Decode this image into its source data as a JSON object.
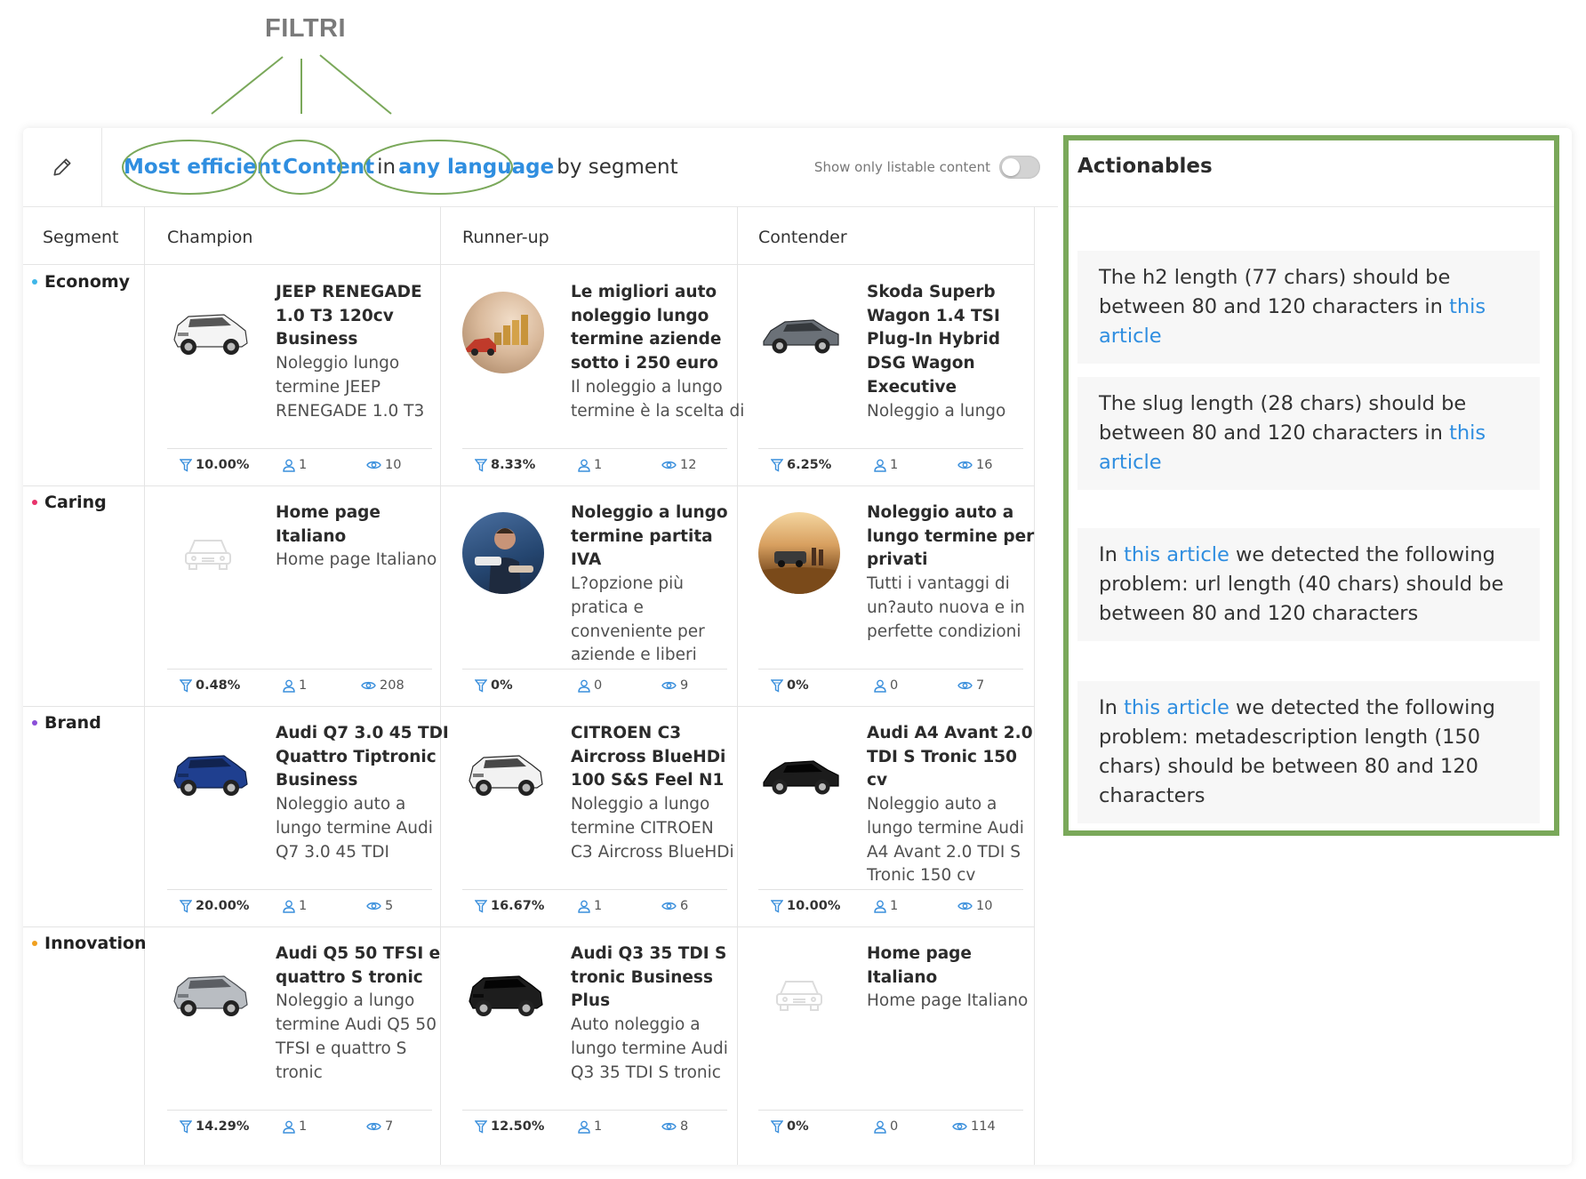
{
  "annotation": {
    "label": "FILTRI"
  },
  "query": {
    "metric": "Most efficient",
    "type": "Content",
    "in_word": "in",
    "language": "any language",
    "suffix": "by segment"
  },
  "listable_label": "Show only listable content",
  "columns": {
    "segment": "Segment",
    "champion": "Champion",
    "runner_up": "Runner-up",
    "contender": "Contender"
  },
  "rows": [
    {
      "segment": "Economy",
      "dot_color": "#3fb6e8",
      "items": [
        {
          "title_lines": [
            "JEEP RENEGADE",
            "1.0 T3 120cv",
            "Business"
          ],
          "desc_lines": [
            "Noleggio lungo",
            "termine JEEP",
            "RENEGADE 1.0 T3"
          ],
          "thumb": "white-suv",
          "efficiency": "10.00%",
          "users": "1",
          "views": "10"
        },
        {
          "title_lines": [
            "Le migliori auto",
            "noleggio lungo",
            "termine aziende",
            "sotto i 250 euro"
          ],
          "desc_lines": [
            "Il noleggio a lungo",
            "termine è la scelta di"
          ],
          "thumb": "coins-photo",
          "efficiency": "8.33%",
          "users": "1",
          "views": "12"
        },
        {
          "title_lines": [
            "Skoda Superb",
            "Wagon 1.4 TSI",
            "Plug-In Hybrid",
            "DSG Wagon",
            "Executive"
          ],
          "desc_lines": [
            "Noleggio a lungo"
          ],
          "thumb": "grey-wagon",
          "efficiency": "6.25%",
          "users": "1",
          "views": "16"
        }
      ]
    },
    {
      "segment": "Caring",
      "dot_color": "#e8336b",
      "items": [
        {
          "title_lines": [
            "Home page Italiano"
          ],
          "desc_lines": [
            "Home page Italiano"
          ],
          "thumb": "car-placeholder",
          "efficiency": "0.48%",
          "users": "1",
          "views": "208"
        },
        {
          "title_lines": [
            "Noleggio a lungo",
            "termine partita IVA"
          ],
          "desc_lines": [
            "L?opzione più",
            "pratica e",
            "conveniente per",
            "aziende e liberi"
          ],
          "thumb": "man-keys-photo",
          "efficiency": "0%",
          "users": "0",
          "views": "9"
        },
        {
          "title_lines": [
            "Noleggio auto a",
            "lungo termine per",
            "privati"
          ],
          "desc_lines": [
            "Tutti i vantaggi di",
            "un?auto nuova e in",
            "perfette condizioni"
          ],
          "thumb": "field-photo",
          "efficiency": "0%",
          "users": "0",
          "views": "7"
        }
      ]
    },
    {
      "segment": "Brand",
      "dot_color": "#8a4fd8",
      "items": [
        {
          "title_lines": [
            "Audi Q7 3.0 45 TDI",
            "Quattro Tiptronic",
            "Business"
          ],
          "desc_lines": [
            "Noleggio auto a",
            "lungo termine Audi",
            "Q7 3.0 45 TDI"
          ],
          "thumb": "blue-suv",
          "efficiency": "20.00%",
          "users": "1",
          "views": "5"
        },
        {
          "title_lines": [
            "CITROEN C3",
            "Aircross BlueHDi",
            "100 S&S Feel N1"
          ],
          "desc_lines": [
            "Noleggio a lungo",
            "termine CITROEN",
            "C3 Aircross BlueHDi"
          ],
          "thumb": "white-crossover",
          "efficiency": "16.67%",
          "users": "1",
          "views": "6"
        },
        {
          "title_lines": [
            "Audi A4 Avant 2.0",
            "TDI S Tronic 150 cv"
          ],
          "desc_lines": [
            "Noleggio auto a",
            "lungo termine Audi",
            "A4 Avant 2.0 TDI S",
            "Tronic 150 cv"
          ],
          "thumb": "black-wagon",
          "efficiency": "10.00%",
          "users": "1",
          "views": "10"
        }
      ]
    },
    {
      "segment": "Innovation",
      "dot_color": "#f0a020",
      "items": [
        {
          "title_lines": [
            "Audi Q5 50 TFSI e",
            "quattro S tronic"
          ],
          "desc_lines": [
            "Noleggio a lungo",
            "termine Audi Q5 50",
            "TFSI e quattro S",
            "tronic"
          ],
          "thumb": "silver-suv",
          "efficiency": "14.29%",
          "users": "1",
          "views": "7"
        },
        {
          "title_lines": [
            "Audi Q3 35 TDI S",
            "tronic Business",
            "Plus"
          ],
          "desc_lines": [
            "Auto noleggio a",
            "lungo termine Audi",
            "Q3 35 TDI S tronic"
          ],
          "thumb": "black-suv",
          "efficiency": "12.50%",
          "users": "1",
          "views": "8"
        },
        {
          "title_lines": [
            "Home page Italiano"
          ],
          "desc_lines": [
            "Home page Italiano"
          ],
          "thumb": "car-placeholder",
          "efficiency": "0%",
          "users": "0",
          "views": "114"
        }
      ]
    }
  ],
  "actionables": {
    "title": "Actionables",
    "link_text": "this article",
    "items": [
      {
        "before": "The h2 length (77 chars) should be between 80 and 120 characters in ",
        "after": ""
      },
      {
        "before": "The slug length (28 chars) should be between 80 and 120 characters in ",
        "after": ""
      },
      {
        "before": "In ",
        "after": " we detected the following problem: url length (40 chars) should be between 80 and 120 characters"
      },
      {
        "before": "In ",
        "after": " we detected the following problem: metadescription length (150 chars) should be between 80 and 120 characters"
      }
    ]
  },
  "colors": {
    "link": "#2f8ee0",
    "annotation_green": "#7aa85a",
    "stat_icon": "#3a8fdc"
  }
}
